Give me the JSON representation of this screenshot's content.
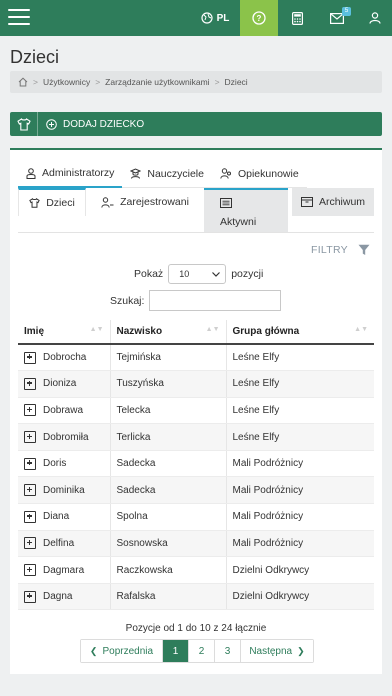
{
  "topbar": {
    "language": "PL",
    "mail_badge": "5",
    "icons": [
      "menu-icon",
      "globe-icon",
      "help-icon",
      "calculator-icon",
      "mail-icon",
      "user-icon"
    ],
    "accent": "#2e7d5b",
    "help_bg": "#8bc34a"
  },
  "page": {
    "title": "Dzieci"
  },
  "breadcrumb": [
    "Użytkownicy",
    "Zarządzanie użytkownikami",
    "Dzieci"
  ],
  "add_child_label": "DODAJ DZIECKO",
  "role_tabs": [
    {
      "label": "Administratorzy",
      "icon": "admin-user-icon",
      "active": true
    },
    {
      "label": "Nauczyciele",
      "icon": "teacher-icon",
      "active": false
    },
    {
      "label": "Opiekunowie",
      "icon": "guardian-icon",
      "active": false
    }
  ],
  "sub_tabs": [
    {
      "label": "Dzieci",
      "icon": "shirt-icon"
    },
    {
      "label": "Zarejestrowani",
      "icon": "registered-user-icon"
    },
    {
      "label": "Aktywni",
      "icon": "list-icon"
    },
    {
      "label": "Archiwum",
      "icon": "archive-icon"
    }
  ],
  "filters_label": "FILTRY",
  "show": {
    "prefix": "Pokaż",
    "value": "10",
    "suffix": "pozycji"
  },
  "search": {
    "label": "Szukaj:",
    "value": ""
  },
  "table": {
    "columns": [
      "Imię",
      "Nazwisko",
      "Grupa główna"
    ],
    "rows": [
      [
        "Dobrocha",
        "Tejmińska",
        "Leśne Elfy"
      ],
      [
        "Dioniza",
        "Tuszyńska",
        "Leśne Elfy"
      ],
      [
        "Dobrawa",
        "Telecka",
        "Leśne Elfy"
      ],
      [
        "Dobromiła",
        "Terlicka",
        "Leśne Elfy"
      ],
      [
        "Doris",
        "Sadecka",
        "Mali Podróżnicy"
      ],
      [
        "Dominika",
        "Sadecka",
        "Mali Podróżnicy"
      ],
      [
        "Diana",
        "Spolna",
        "Mali Podróżnicy"
      ],
      [
        "Delfina",
        "Sosnowska",
        "Mali Podróżnicy"
      ],
      [
        "Dagmara",
        "Raczkowska",
        "Dzielni Odkrywcy"
      ],
      [
        "Dagna",
        "Rafalska",
        "Dzielni Odkrywcy"
      ]
    ]
  },
  "info": "Pozycje od 1 do 10 z 24 łącznie",
  "pagination": {
    "prev": "Poprzednia",
    "pages": [
      "1",
      "2",
      "3"
    ],
    "current": "1",
    "next": "Następna"
  }
}
